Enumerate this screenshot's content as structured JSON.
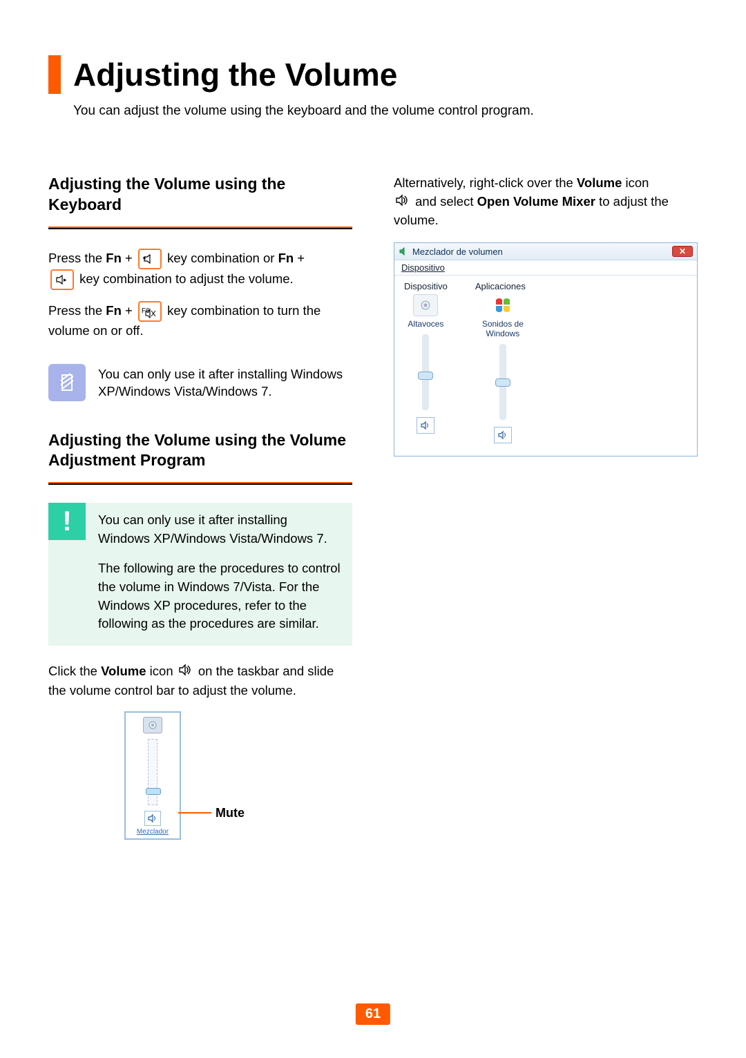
{
  "page": {
    "title": "Adjusting the Volume",
    "intro": "You can adjust the volume using the keyboard and the volume control program.",
    "number": "61"
  },
  "left": {
    "heading1": "Adjusting the Volume using the Keyboard",
    "p1_a": "Press the ",
    "fn": "Fn",
    "p1_b": " + ",
    "p1_c": " key combination or ",
    "p1_d": " + ",
    "p1_e": " key combination to adjust the volume.",
    "p2_a": "Press the ",
    "p2_b": " + ",
    "p2_c": " key combination to turn the volume on or off.",
    "key_f6": "F6",
    "note1": "You can only use it after installing Windows XP/Windows Vista/Windows 7.",
    "heading2": "Adjusting the Volume using the Volume Adjustment Program",
    "warn_p1": "You can only use it after installing Windows XP/Windows Vista/Windows 7.",
    "warn_p2": "The following are the procedures to control the volume in Windows 7/Vista. For the Windows XP procedures, refer to the following as the procedures are similar.",
    "p3_a": "Click the ",
    "volume_word": "Volume",
    "p3_b": " icon ",
    "p3_c": " on the taskbar and slide the volume control bar to adjust the volume.",
    "popup": {
      "mixer_link": "Mezclador",
      "mute_label": "Mute"
    }
  },
  "right": {
    "p1_a": "Alternatively, right-click over the ",
    "volume_word": "Volume",
    "p1_b": " icon ",
    "p1_c": " and select ",
    "open_mixer": "Open Volume Mixer",
    "p1_d": " to adjust the volume.",
    "mixer": {
      "title": "Mezclador de volumen",
      "menu": "Dispositivo",
      "col1_header": "Dispositivo",
      "col2_header": "Aplicaciones",
      "col1_caption": "Altavoces",
      "col2_caption": "Sonidos de Windows"
    }
  }
}
